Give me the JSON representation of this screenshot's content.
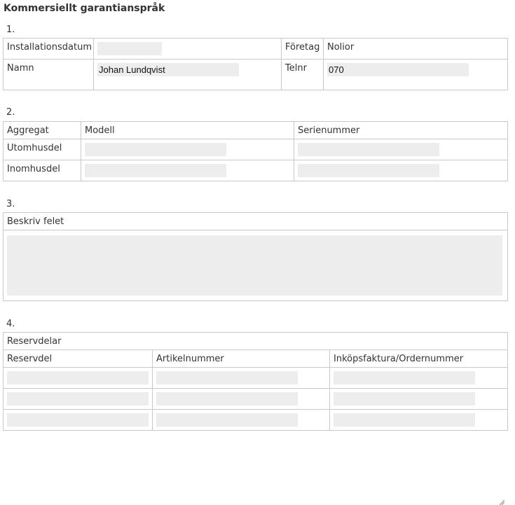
{
  "page": {
    "title": "Kommersiellt garantianspråk"
  },
  "section1": {
    "number": "1.",
    "installation_date_label": "Installationsdatum",
    "installation_date_value": "",
    "company_label": "Företag",
    "company_value": "Nolior",
    "name_label": "Namn",
    "name_value": "Johan Lundqvist",
    "phone_label": "Telnr",
    "phone_value": "070"
  },
  "section2": {
    "number": "2.",
    "headers": [
      "Aggregat",
      "Modell",
      "Serienummer"
    ],
    "rows": [
      {
        "label": "Utomhusdel",
        "model": "",
        "serial": ""
      },
      {
        "label": "Inomhusdel",
        "model": "",
        "serial": ""
      }
    ]
  },
  "section3": {
    "number": "3.",
    "description_label": "Beskriv felet",
    "description_value": ""
  },
  "section4": {
    "number": "4.",
    "title": "Reservdelar",
    "headers": [
      "Reservdel",
      "Artikelnummer",
      "Inköpsfaktura/Ordernummer"
    ],
    "rows": [
      {
        "part": "",
        "article": "",
        "invoice": ""
      },
      {
        "part": "",
        "article": "",
        "invoice": ""
      },
      {
        "part": "",
        "article": "",
        "invoice": ""
      }
    ]
  }
}
